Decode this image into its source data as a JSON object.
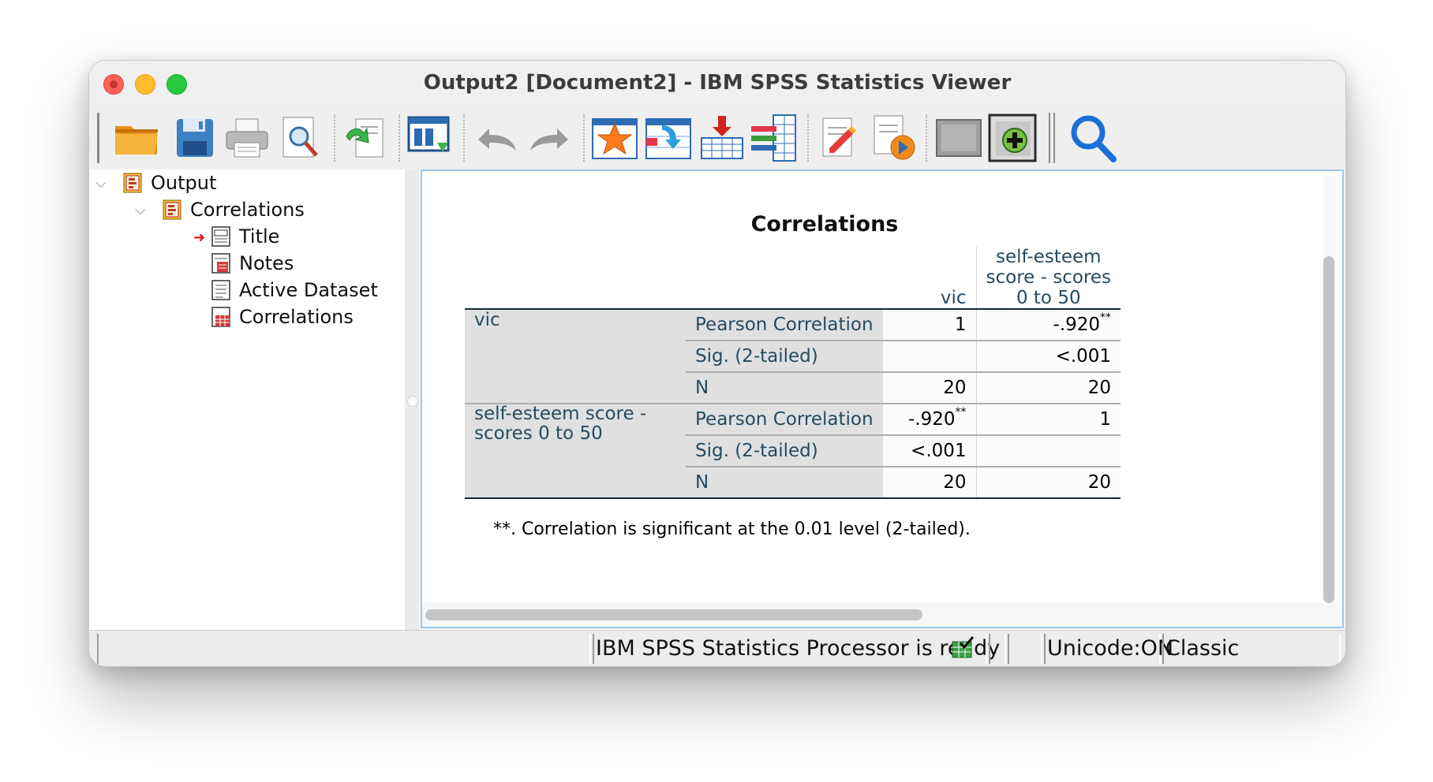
{
  "window": {
    "title": "Output2 [Document2] - IBM SPSS Statistics Viewer"
  },
  "toolbar": {
    "icons": [
      "open-folder-icon",
      "save-icon",
      "print-icon",
      "print-preview-icon",
      "export-icon",
      "recall-dialog-icon",
      "undo-icon",
      "redo-icon",
      "goto-data-icon",
      "goto-case-icon",
      "goto-variable-icon",
      "variables-icon",
      "designate-window-icon",
      "run-script-icon",
      "collapse-icon",
      "insert-output-icon",
      "search-icon"
    ]
  },
  "tree": {
    "items": [
      {
        "label": "Output",
        "level": 0,
        "expanded": true
      },
      {
        "label": "Correlations",
        "level": 1,
        "expanded": true
      },
      {
        "label": "Title",
        "level": 2,
        "selected": true
      },
      {
        "label": "Notes",
        "level": 2
      },
      {
        "label": "Active Dataset",
        "level": 2
      },
      {
        "label": "Correlations",
        "level": 2
      }
    ]
  },
  "table": {
    "title": "Correlations",
    "col_headers": {
      "vic": "vic",
      "se_line1": "self-esteem",
      "se_line2": "score - scores",
      "se_line3": "0 to 50"
    },
    "rows": [
      {
        "label": "vic",
        "label_line2": "",
        "stats": [
          "Pearson Correlation",
          "Sig. (2-tailed)",
          "N"
        ],
        "vic": [
          "1",
          "",
          "20"
        ],
        "se": [
          "-.920",
          "<.001",
          "20"
        ],
        "se_sig": "**",
        "vic_sig": ""
      },
      {
        "label": "self-esteem score -",
        "label_line2": "scores 0 to 50",
        "stats": [
          "Pearson Correlation",
          "Sig. (2-tailed)",
          "N"
        ],
        "vic": [
          "-.920",
          "<.001",
          "20"
        ],
        "se": [
          "1",
          "",
          "20"
        ],
        "vic_sig": "**",
        "se_sig": ""
      }
    ],
    "footnote": "**. Correlation is significant at the 0.01 level (2-tailed)."
  },
  "status": {
    "processor": "IBM SPSS Statistics Processor is ready",
    "unicode": "Unicode:ON",
    "mode": "Classic"
  },
  "colors": {
    "table_text": "#264a60",
    "row_header_bg": "#e0e0e0",
    "accent_border": "#9ec8ec"
  }
}
